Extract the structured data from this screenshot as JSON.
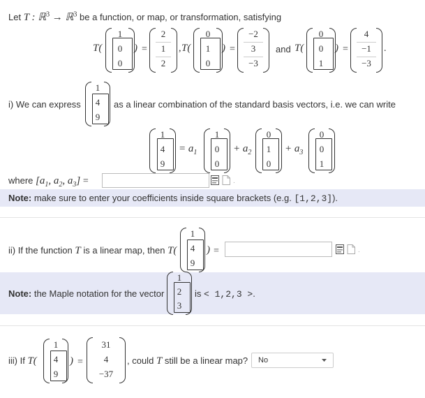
{
  "intro": {
    "lead": "Let",
    "func_math": "T : ℝ",
    "exp1": "3",
    "arrow": "→ ℝ",
    "exp2": "3",
    "tail": "be a function, or map, or transformation, satisfying"
  },
  "given": {
    "T": "T(",
    "close": ")",
    "eq": "=",
    "comma": ",",
    "and": "and",
    "period": ".",
    "pairs": [
      {
        "in": [
          "1",
          "0",
          "0"
        ],
        "out": [
          "2",
          "1",
          "2"
        ]
      },
      {
        "in": [
          "0",
          "1",
          "0"
        ],
        "out": [
          "−2",
          "3",
          "−3"
        ]
      },
      {
        "in": [
          "0",
          "0",
          "1"
        ],
        "out": [
          "4",
          "−1",
          "−3"
        ]
      }
    ]
  },
  "part_i": {
    "label": "i) We can express",
    "vec": [
      "1",
      "4",
      "9"
    ],
    "text": "as a linear combination of the standard basis vectors, i.e. we can write",
    "eq_vec": [
      "1",
      "4",
      "9"
    ],
    "eq": "= a",
    "sub1": "1",
    "plus2": "+ a",
    "sub2": "2",
    "plus3": "+ a",
    "sub3": "3",
    "e1": [
      "1",
      "0",
      "0"
    ],
    "e2": [
      "0",
      "1",
      "0"
    ],
    "e3": [
      "0",
      "0",
      "1"
    ],
    "where": "where",
    "bracket_expr": "[a",
    "bracket_rest": ", a",
    "bracket_close": "]",
    "s1": "1",
    "s2": "2",
    "s3": "3",
    "answer_value": "",
    "note_bold": "Note:",
    "note_text": "make sure to enter your coefficients inside square brackets (e.g.",
    "note_code": "[1,2,3]",
    "note_end": ")."
  },
  "part_ii": {
    "label": "ii) If the function",
    "T": "T",
    "mid": "is a linear map, then",
    "Tcall": "T(",
    "vec": [
      "1",
      "4",
      "9"
    ],
    "close": ")",
    "eq": "=",
    "answer_value": "",
    "note_bold": "Note:",
    "note_text": "the Maple notation for the vector",
    "note_vec": [
      "1",
      "2",
      "3"
    ],
    "note_is": "is",
    "note_code": "< 1,2,3 >",
    "note_end": "."
  },
  "part_iii": {
    "label": "iii) If",
    "Tcall": "T(",
    "vec": [
      "1",
      "4",
      "9"
    ],
    "close": ")",
    "eq": "=",
    "out": [
      "31",
      "4",
      "−37"
    ],
    "question": ", could",
    "T": "T",
    "question_end": "still be a linear map?",
    "selected": "No"
  },
  "icons": {
    "preview": "preview-icon",
    "help": "document-icon",
    "caret": "chevron-down-icon"
  }
}
